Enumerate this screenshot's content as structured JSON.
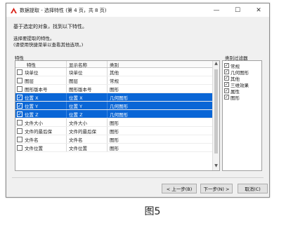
{
  "window": {
    "title": "数据提取 - 选择特性 (第 4 页，共 8 页)",
    "controls": {
      "minimize": "—",
      "maximize": "☐",
      "close": "✕"
    }
  },
  "intro": "基于选定的对象，找到以下特性。",
  "prompt": {
    "line1": "选择要提取的特性。",
    "line2": "(请使用快捷菜单以查看其他选项。)"
  },
  "properties": {
    "label": "特性",
    "columns": [
      "特性",
      "显示名称",
      "类别"
    ],
    "rows": [
      {
        "checked": false,
        "selected": false,
        "property": "块单位",
        "display": "块单位",
        "category": "其他"
      },
      {
        "checked": false,
        "selected": false,
        "property": "图层",
        "display": "图层",
        "category": "常规"
      },
      {
        "checked": false,
        "selected": false,
        "property": "图形版本号",
        "display": "图形版本号",
        "category": "图形"
      },
      {
        "checked": true,
        "selected": true,
        "property": "位置 X",
        "display": "位置 X",
        "category": "几何图形"
      },
      {
        "checked": true,
        "selected": true,
        "property": "位置 Y",
        "display": "位置 Y",
        "category": "几何图形"
      },
      {
        "checked": true,
        "selected": true,
        "property": "位置 Z",
        "display": "位置 Z",
        "category": "几何图形"
      },
      {
        "checked": false,
        "selected": false,
        "property": "文件大小",
        "display": "文件大小",
        "category": "图形"
      },
      {
        "checked": false,
        "selected": false,
        "property": "文件的最后保",
        "display": "文件的最后保",
        "category": "图形"
      },
      {
        "checked": false,
        "selected": false,
        "property": "文件名",
        "display": "文件名",
        "category": "图形"
      },
      {
        "checked": false,
        "selected": false,
        "property": "文件位置",
        "display": "文件位置",
        "category": "图形"
      }
    ]
  },
  "filter": {
    "label": "类别过滤器",
    "items": [
      {
        "label": "常规",
        "checked": true
      },
      {
        "label": "几何图形",
        "checked": true
      },
      {
        "label": "其他",
        "checked": true
      },
      {
        "label": "三维效果",
        "checked": true
      },
      {
        "label": "属性",
        "checked": true
      },
      {
        "label": "图形",
        "checked": true
      }
    ]
  },
  "buttons": {
    "back": "< 上一步(B)",
    "next": "下一步(N) >",
    "cancel": "取消(C)"
  },
  "caption": "图5",
  "colors": {
    "selection": "#0a66d6",
    "dialog_bg": "#f0f0f0",
    "title_icon": "#d9261c"
  },
  "icons": {
    "app": "autocad-a-icon",
    "scroll_up": "scroll-up-icon",
    "scroll_down": "scroll-down-icon"
  }
}
